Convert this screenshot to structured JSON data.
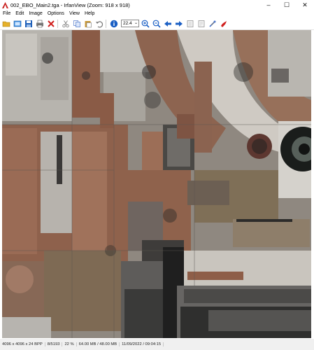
{
  "window": {
    "title": "002_EBO_Main2.tga - IrfanView (Zoom: 918 x 918)",
    "controls": {
      "minimize": "–",
      "maximize": "☐",
      "close": "✕"
    }
  },
  "menu": [
    "File",
    "Edit",
    "Image",
    "Options",
    "View",
    "Help"
  ],
  "toolbar": {
    "buttons": [
      {
        "name": "open-icon",
        "color": "#d9a21b"
      },
      {
        "name": "slideshow-icon",
        "color": "#2a7fd4"
      },
      {
        "name": "save-icon",
        "color": "#1f5fb8"
      },
      {
        "name": "print-icon",
        "color": "#555555"
      },
      {
        "name": "delete-icon",
        "color": "#d0201e"
      },
      {
        "name": "cut-icon",
        "color": "#777777"
      },
      {
        "name": "copy-icon",
        "color": "#4a74c9"
      },
      {
        "name": "paste-icon",
        "color": "#b88a2a"
      },
      {
        "name": "undo-icon",
        "color": "#666666"
      },
      {
        "name": "info-icon",
        "color": "#1b5fc4"
      }
    ],
    "zoom_value": "22.4",
    "nav_buttons": [
      {
        "name": "zoom-in-icon",
        "color": "#1b5fc4"
      },
      {
        "name": "zoom-out-icon",
        "color": "#1b5fc4"
      },
      {
        "name": "previous-icon",
        "color": "#1b5fc4"
      },
      {
        "name": "next-icon",
        "color": "#1b5fc4"
      },
      {
        "name": "first-icon",
        "color": "#888888"
      },
      {
        "name": "last-icon",
        "color": "#888888"
      },
      {
        "name": "settings-icon",
        "color": "#4a74c9"
      },
      {
        "name": "exit-icon",
        "color": "#d0201e"
      }
    ]
  },
  "status": {
    "dimensions": "4096 x 4096 x 24 BPP",
    "index": "8/5193",
    "zoom": "22 %",
    "memory": "64.00 MB / 48.00 MB",
    "datetime": "11/09/2022 / 09:04:15"
  },
  "image": {
    "description_name": "texture-image"
  }
}
